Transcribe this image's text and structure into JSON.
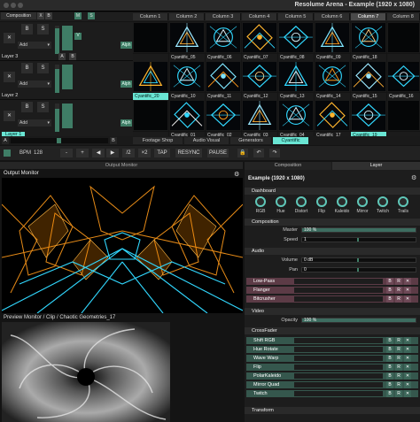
{
  "window_title": "Resolume Arena - Example (1920 x 1080)",
  "composition_label": "Composition",
  "top_buttons": {
    "x": "X",
    "b": "B",
    "s": "S",
    "m": "M",
    "ss": "S"
  },
  "columns": [
    "Column 1",
    "Column 2",
    "Column 3",
    "Column 4",
    "Column 5",
    "Column 6",
    "Column 7",
    "Column 8"
  ],
  "layers": [
    {
      "name": "Layer 3",
      "add": "Add",
      "clip_names": [
        "",
        "Cyantific_05",
        "Cyantific_06",
        "Cyantific_07",
        "Cyantific_08",
        "Cyantific_09",
        "Cyantific_18",
        ""
      ]
    },
    {
      "name": "Layer 2",
      "add": "Add",
      "clip_names": [
        "Cyantific_20",
        "Cyantific_10",
        "Cyantific_11",
        "Cyantific_12",
        "Cyantific_13",
        "Cyantific_14",
        "Cyantific_15",
        "Cyantific_16"
      ]
    },
    {
      "name": "Layer 1",
      "add": "Add",
      "clip_names": [
        "",
        "Cyantific_01",
        "Cyantific_02",
        "Cyantific_03",
        "Cyantific_04",
        "Cyantific_17",
        "Cyantific_19",
        ""
      ]
    }
  ],
  "alph_label": "Alph",
  "row_letters": {
    "a": "A",
    "b": "B"
  },
  "tabs": [
    "Footage Shop",
    "Audio Visual",
    "Generators",
    "Cyantific"
  ],
  "transport": {
    "bpm_label": "BPM",
    "bpm_value": "128",
    "minus": "-",
    "plus": "+",
    "div": "/2",
    "mul": "×2",
    "tap": "TAP",
    "resync": "RESYNC",
    "pause": "PAUSE"
  },
  "output_header": "Output Monitor",
  "output_label": "Output Monitor",
  "preview_label": "Preview Monitor / Clip / Chaotic Geometries_17",
  "right_tabs": [
    "Composition",
    "Layer"
  ],
  "comp_title": "Example (1920 x 1080)",
  "dashboard": {
    "label": "Dashboard",
    "knobs": [
      "RGB",
      "Hue",
      "Distort",
      "Flip",
      "Kaleido",
      "Mirror",
      "Twitch",
      "Trails"
    ]
  },
  "composition_section": {
    "label": "Composition",
    "master_label": "Master",
    "master_value": "100 %",
    "master_level": 1.0,
    "speed_label": "Speed",
    "speed_value": "1",
    "speed_level": 0.5
  },
  "audio_section": {
    "label": "Audio",
    "volume_label": "Volume",
    "volume_value": "0 dB",
    "volume_level": 0.5,
    "pan_label": "Pan",
    "pan_value": "0",
    "pan_level": 0.5
  },
  "effects_a": [
    "Low-Pass",
    "Flanger",
    "Bitcrusher"
  ],
  "video_section": {
    "label": "Video",
    "opacity_label": "Opacity",
    "opacity_value": "100 %",
    "opacity_level": 1.0
  },
  "crossfader_label": "CrossFader",
  "effects_b": [
    "Shift RGB",
    "Hue Rotate",
    "Wave Warp",
    "Flip",
    "PolarKaleido",
    "Mirror Quad",
    "Twitch"
  ],
  "transform_label": "Transform",
  "fx_buttons": {
    "b": "B",
    "r": "R"
  },
  "colors": {
    "accent": "#6ae6d4",
    "audio_fx": "#5c3b46",
    "video_fx": "#35574d",
    "orange": "#ff9a1a",
    "cyan": "#31d8ff"
  }
}
